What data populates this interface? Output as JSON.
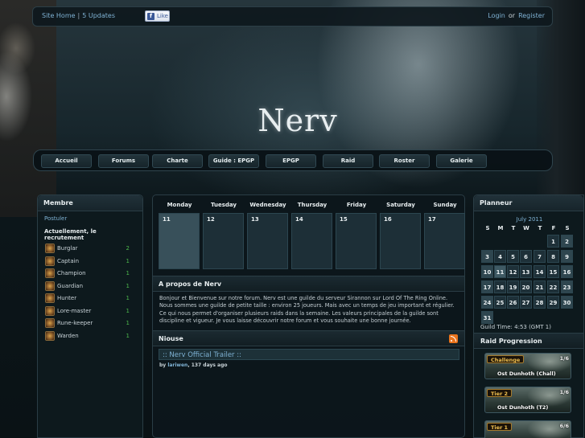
{
  "header": {
    "site_home": "Site Home",
    "separator": "|",
    "updates": "5 Updates",
    "like_label": "Like",
    "login": "Login",
    "or": "or",
    "register": "Register"
  },
  "logo": {
    "text": "Nerv"
  },
  "nav": {
    "items": [
      "Accueil",
      "Forums",
      "Charte",
      "Guide : EPGP",
      "EPGP",
      "Raid",
      "Roster",
      "Galerie"
    ]
  },
  "membre": {
    "title": "Membre",
    "postuler": "Postuler",
    "recruit_title": "Actuellement, le recrutement",
    "classes": [
      {
        "name": "Burglar",
        "count": "2"
      },
      {
        "name": "Captain",
        "count": "1"
      },
      {
        "name": "Champion",
        "count": "1"
      },
      {
        "name": "Guardian",
        "count": "1"
      },
      {
        "name": "Hunter",
        "count": "1"
      },
      {
        "name": "Lore-master",
        "count": "1"
      },
      {
        "name": "Rune-keeper",
        "count": "1"
      },
      {
        "name": "Warden",
        "count": "1"
      }
    ]
  },
  "calendar": {
    "days": [
      "Monday",
      "Tuesday",
      "Wednesday",
      "Thursday",
      "Friday",
      "Saturday",
      "Sunday"
    ],
    "dates": [
      "11",
      "12",
      "13",
      "14",
      "15",
      "16",
      "17"
    ]
  },
  "about": {
    "title": "A propos de Nerv",
    "text": "Bonjour et Bienvenue sur notre forum. Nerv est une guilde du serveur Sirannon sur Lord Of The Ring Online. Nous sommes une guilde de petite taille : environ 25 joueurs. Mais avec un temps de jeu important et régulier. Ce qui nous permet d'organiser plusieurs raids dans la semaine. Les valeurs principales de la guilde sont discipline et vigueur. Je vous laisse découvrir notre forum et vous souhaite une bonne journée."
  },
  "news": {
    "title": "Niouse",
    "item_title": ":: Nerv Official Trailer ::",
    "by": "by",
    "author": "lariwen",
    "age": ", 137 days ago"
  },
  "planner": {
    "title": "Planneur",
    "month": "July 2011",
    "weekdays": [
      "S",
      "M",
      "T",
      "W",
      "T",
      "F",
      "S"
    ],
    "weeks": [
      [
        "",
        "",
        "",
        "",
        "",
        "1",
        "2"
      ],
      [
        "3",
        "4",
        "5",
        "6",
        "7",
        "8",
        "9"
      ],
      [
        "10",
        "11",
        "12",
        "13",
        "14",
        "15",
        "16"
      ],
      [
        "17",
        "18",
        "19",
        "20",
        "21",
        "22",
        "23"
      ],
      [
        "24",
        "25",
        "26",
        "27",
        "28",
        "29",
        "30"
      ],
      [
        "31",
        "",
        "",
        "",
        "",
        "",
        ""
      ]
    ],
    "guild_time": "Guild Time: 4:53 (GMT 1)"
  },
  "raid_progression": {
    "title": "Raid Progression",
    "raids": [
      {
        "tier": "Challenge",
        "count": "1/6",
        "name": "Ost Dunhoth (Chall)"
      },
      {
        "tier": "Tier 2",
        "count": "1/6",
        "name": "Ost Dunhoth (T2)"
      },
      {
        "tier": "Tier 1",
        "count": "6/6",
        "name": ""
      }
    ]
  }
}
